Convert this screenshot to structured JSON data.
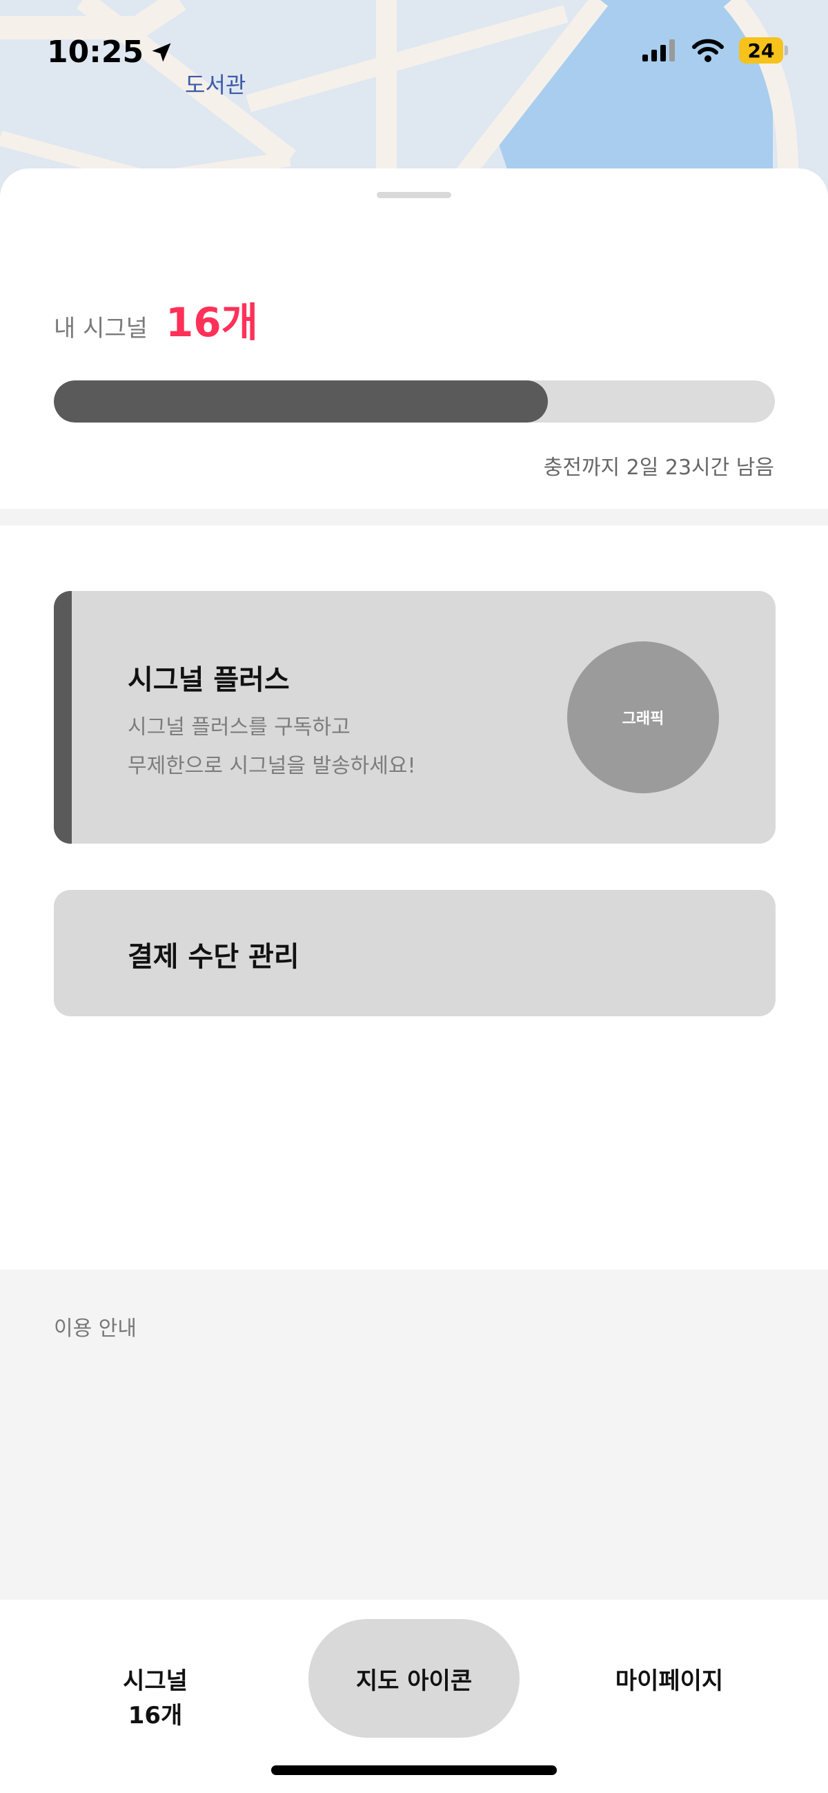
{
  "status_bar": {
    "time": "10:25",
    "battery": "24"
  },
  "map": {
    "label": "도서관"
  },
  "signal": {
    "label": "내 시그널",
    "count": "16개",
    "progress_fraction": 0.685,
    "recharge_text": "충전까지 2일 23시간 남음"
  },
  "plus_card": {
    "title": "시그널 플러스",
    "desc_line1": "시그널 플러스를 구독하고",
    "desc_line2": "무제한으로 시그널을 발송하세요!",
    "graphic_label": "그래픽"
  },
  "payment_card": {
    "title": "결제 수단 관리"
  },
  "guide": {
    "title": "이용 안내"
  },
  "tabbar": {
    "signal_line1": "시그널",
    "signal_line2": "16개",
    "map_label": "지도 아이콘",
    "mypage_label": "마이페이지"
  },
  "colors": {
    "accent": "#ff3158",
    "progress_fill": "#5a5a5a",
    "card_bg": "#d9d9d9",
    "battery": "#f6c21b"
  }
}
